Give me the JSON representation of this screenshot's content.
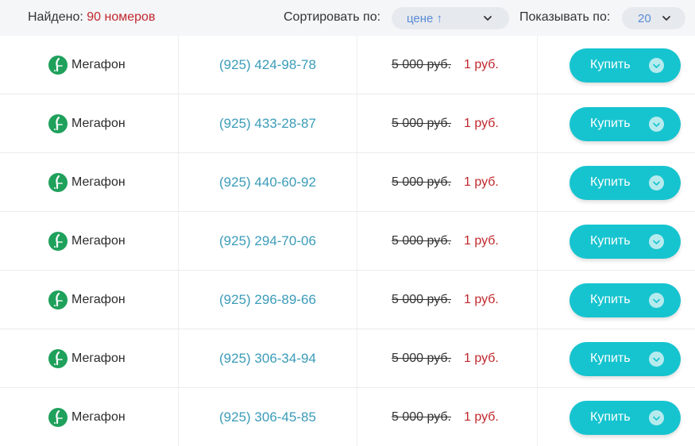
{
  "header": {
    "found_label": "Найдено:",
    "found_count": "90 номеров",
    "sort_label": "Сортировать по:",
    "sort_value": "цене ↑",
    "show_label": "Показывать по:",
    "show_value": "20"
  },
  "icons": {
    "sort_chevron": "chevron-down-icon",
    "operator_logo": "megafon-logo-icon",
    "buy_check": "check-circle-icon"
  },
  "colors": {
    "accent": "#16c4cf",
    "price_red": "#c0272d",
    "phone_link": "#3a9bb8",
    "operator_green": "#1fa15c"
  },
  "rows": [
    {
      "operator": "Мегафон",
      "phone": "(925) 424-98-78",
      "old_price": "5 000 руб.",
      "new_price": "1 руб.",
      "buy_label": "Купить"
    },
    {
      "operator": "Мегафон",
      "phone": "(925) 433-28-87",
      "old_price": "5 000 руб.",
      "new_price": "1 руб.",
      "buy_label": "Купить"
    },
    {
      "operator": "Мегафон",
      "phone": "(925) 440-60-92",
      "old_price": "5 000 руб.",
      "new_price": "1 руб.",
      "buy_label": "Купить"
    },
    {
      "operator": "Мегафон",
      "phone": "(925) 294-70-06",
      "old_price": "5 000 руб.",
      "new_price": "1 руб.",
      "buy_label": "Купить"
    },
    {
      "operator": "Мегафон",
      "phone": "(925) 296-89-66",
      "old_price": "5 000 руб.",
      "new_price": "1 руб.",
      "buy_label": "Купить"
    },
    {
      "operator": "Мегафон",
      "phone": "(925) 306-34-94",
      "old_price": "5 000 руб.",
      "new_price": "1 руб.",
      "buy_label": "Купить"
    },
    {
      "operator": "Мегафон",
      "phone": "(925) 306-45-85",
      "old_price": "5 000 руб.",
      "new_price": "1 руб.",
      "buy_label": "Купить"
    }
  ]
}
